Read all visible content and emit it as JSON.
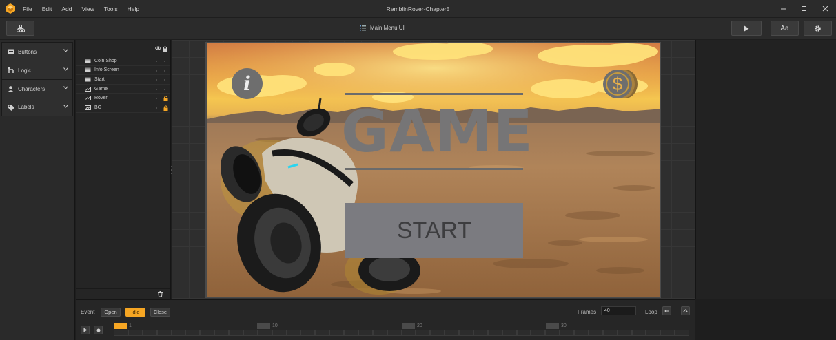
{
  "window": {
    "title": "RemblinRover-Chapter5"
  },
  "menu": [
    "File",
    "Edit",
    "Add",
    "View",
    "Tools",
    "Help"
  ],
  "toolbar": {
    "scene_name": "Main Menu UI",
    "font_button_label": "Aa"
  },
  "categories": [
    {
      "label": "Buttons",
      "icon": "button-icon"
    },
    {
      "label": "Logic",
      "icon": "logic-icon"
    },
    {
      "label": "Characters",
      "icon": "person-icon"
    },
    {
      "label": "Labels",
      "icon": "tag-icon"
    }
  ],
  "layers": [
    {
      "name": "Coin Shop",
      "icon": "ui-element-icon",
      "locked": false
    },
    {
      "name": "Info Screen",
      "icon": "ui-element-icon",
      "locked": false
    },
    {
      "name": "Start",
      "icon": "ui-element-icon",
      "locked": false
    },
    {
      "name": "Game",
      "icon": "image-icon",
      "locked": false
    },
    {
      "name": "Rover",
      "icon": "image-icon",
      "locked": true
    },
    {
      "name": "BG",
      "icon": "image-icon",
      "locked": true
    }
  ],
  "preview": {
    "title_text": "GAME",
    "start_label": "START",
    "info_glyph": "i",
    "coin_glyph": "$"
  },
  "timeline": {
    "event_label": "Event",
    "events": [
      {
        "label": "Open",
        "active": false
      },
      {
        "label": "Idle",
        "active": true
      },
      {
        "label": "Close",
        "active": false
      }
    ],
    "frames_label": "Frames",
    "frames_value": "40",
    "loop_label": "Loop",
    "frame_markers": [
      "1",
      "10",
      "20",
      "30"
    ]
  },
  "colors": {
    "accent": "#f6a623",
    "lock": "#f6a623",
    "button_gray": "#7b7b80"
  }
}
